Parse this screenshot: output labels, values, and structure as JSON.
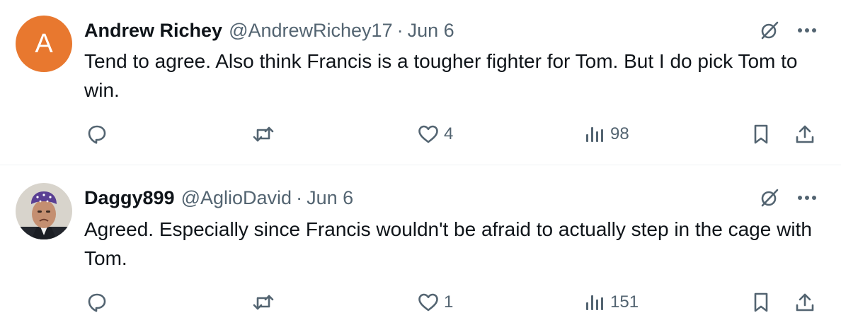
{
  "tweets": [
    {
      "avatar_letter": "A",
      "avatar_color": "#e8782f",
      "display_name": "Andrew Richey",
      "handle": "@AndrewRichey17",
      "separator": "·",
      "date": "Jun 6",
      "text": "Tend to agree.  Also think Francis is a tougher fighter for Tom.  But I do pick Tom to win.",
      "replies": "",
      "retweets": "",
      "likes": "4",
      "views": "98"
    },
    {
      "avatar_letter": "",
      "avatar_color": "#6b5a8e",
      "display_name": "Daggy899",
      "handle": "@AglioDavid",
      "separator": "·",
      "date": "Jun 6",
      "text": "Agreed. Especially since Francis wouldn't be afraid to actually step in the cage with Tom.",
      "replies": "",
      "retweets": "",
      "likes": "1",
      "views": "151"
    }
  ],
  "icons": {
    "grok": "grok-icon",
    "more": "more-icon",
    "reply": "reply-icon",
    "retweet": "retweet-icon",
    "like": "heart-icon",
    "views": "views-icon",
    "bookmark": "bookmark-icon",
    "share": "share-icon"
  },
  "colors": {
    "text_primary": "#0f1419",
    "text_secondary": "#536471",
    "divider": "#eff3f4"
  }
}
